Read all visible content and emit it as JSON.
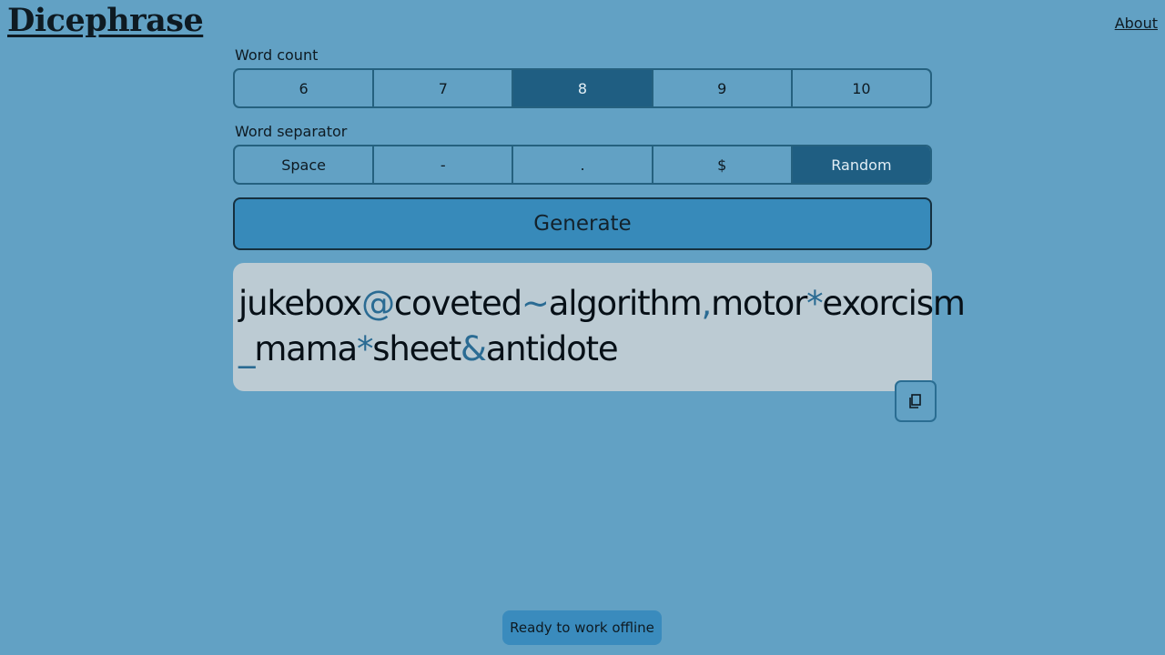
{
  "header": {
    "logo": "Dicephrase",
    "about_link": "About"
  },
  "word_count": {
    "label": "Word count",
    "options": [
      "6",
      "7",
      "8",
      "9",
      "10"
    ],
    "selected": "8"
  },
  "word_separator": {
    "label": "Word separator",
    "options": [
      "Space",
      "-",
      ".",
      "$",
      "Random"
    ],
    "selected": "Random"
  },
  "generate_button": "Generate",
  "passphrase": {
    "tokens": [
      {
        "text": "jukebox",
        "kind": "word"
      },
      {
        "text": "@",
        "kind": "sep"
      },
      {
        "text": "coveted",
        "kind": "word"
      },
      {
        "text": "~",
        "kind": "sep"
      },
      {
        "text": "algorithm",
        "kind": "word"
      },
      {
        "text": ",",
        "kind": "sep"
      },
      {
        "text": "motor",
        "kind": "word"
      },
      {
        "text": "*",
        "kind": "sep"
      },
      {
        "text": "exorcism",
        "kind": "word"
      },
      {
        "text": "_",
        "kind": "sep"
      },
      {
        "text": "mama",
        "kind": "word"
      },
      {
        "text": "*",
        "kind": "sep"
      },
      {
        "text": "sheet",
        "kind": "word"
      },
      {
        "text": "&",
        "kind": "sep"
      },
      {
        "text": "antidote",
        "kind": "word"
      }
    ]
  },
  "copy_button_icon": "copy-icon",
  "status_toast": "Ready to work offline",
  "colors": {
    "background": "#62a1c4",
    "selected_segment": "#1f5e82",
    "generate_button": "#378aba",
    "output_box": "#bccbd3",
    "separator_char": "#2a6b93",
    "toast": "#3a8bbd"
  }
}
